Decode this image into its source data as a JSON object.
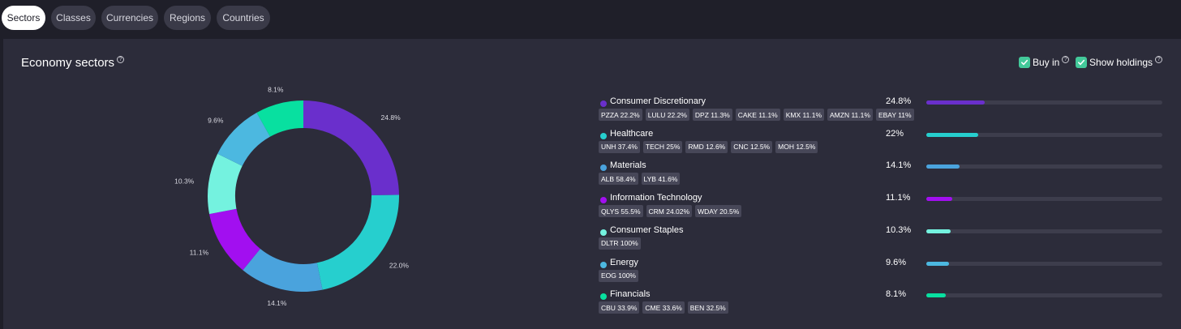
{
  "tabs": [
    {
      "label": "Sectors",
      "active": true
    },
    {
      "label": "Classes",
      "active": false
    },
    {
      "label": "Currencies",
      "active": false
    },
    {
      "label": "Regions",
      "active": false
    },
    {
      "label": "Countries",
      "active": false
    }
  ],
  "panel": {
    "title": "Economy sectors",
    "help_glyph": "?",
    "buy_in_label": "Buy in",
    "show_holdings_label": "Show holdings",
    "buy_in_checked": true,
    "show_holdings_checked": true,
    "check_color": "#43c99a"
  },
  "chart_data": {
    "type": "pie",
    "donut": true,
    "categories": [
      "Consumer Discretionary",
      "Healthcare",
      "Materials",
      "Information Technology",
      "Consumer Staples",
      "Energy",
      "Financials"
    ],
    "values": [
      24.8,
      22.0,
      14.1,
      11.1,
      10.3,
      9.6,
      8.1
    ],
    "value_labels": [
      "24.8%",
      "22.0%",
      "14.1%",
      "11.1%",
      "10.3%",
      "9.6%",
      "8.1%"
    ],
    "colors": [
      "#6a2fcc",
      "#26cfce",
      "#4aa3dd",
      "#a20ff0",
      "#74f2df",
      "#4cb8e0",
      "#08e0a0"
    ]
  },
  "sectors": [
    {
      "name": "Consumer Discretionary",
      "percent": "24.8%",
      "value": 24.8,
      "color": "#6a2fcc",
      "holdings": [
        "PZZA 22.2%",
        "LULU 22.2%",
        "DPZ 11.3%",
        "CAKE 11.1%",
        "KMX 11.1%",
        "AMZN 11.1%",
        "EBAY 11%"
      ]
    },
    {
      "name": "Healthcare",
      "percent": "22%",
      "value": 22.0,
      "color": "#26cfce",
      "holdings": [
        "UNH 37.4%",
        "TECH 25%",
        "RMD 12.6%",
        "CNC 12.5%",
        "MOH 12.5%"
      ]
    },
    {
      "name": "Materials",
      "percent": "14.1%",
      "value": 14.1,
      "color": "#4aa3dd",
      "holdings": [
        "ALB 58.4%",
        "LYB 41.6%"
      ]
    },
    {
      "name": "Information Technology",
      "percent": "11.1%",
      "value": 11.1,
      "color": "#a20ff0",
      "holdings": [
        "QLYS 55.5%",
        "CRM 24.02%",
        "WDAY 20.5%"
      ]
    },
    {
      "name": "Consumer Staples",
      "percent": "10.3%",
      "value": 10.3,
      "color": "#74f2df",
      "holdings": [
        "DLTR 100%"
      ]
    },
    {
      "name": "Energy",
      "percent": "9.6%",
      "value": 9.6,
      "color": "#4cb8e0",
      "holdings": [
        "EOG 100%"
      ]
    },
    {
      "name": "Financials",
      "percent": "8.1%",
      "value": 8.1,
      "color": "#08e0a0",
      "holdings": [
        "CBU 33.9%",
        "CME 33.6%",
        "BEN 32.5%"
      ]
    }
  ]
}
